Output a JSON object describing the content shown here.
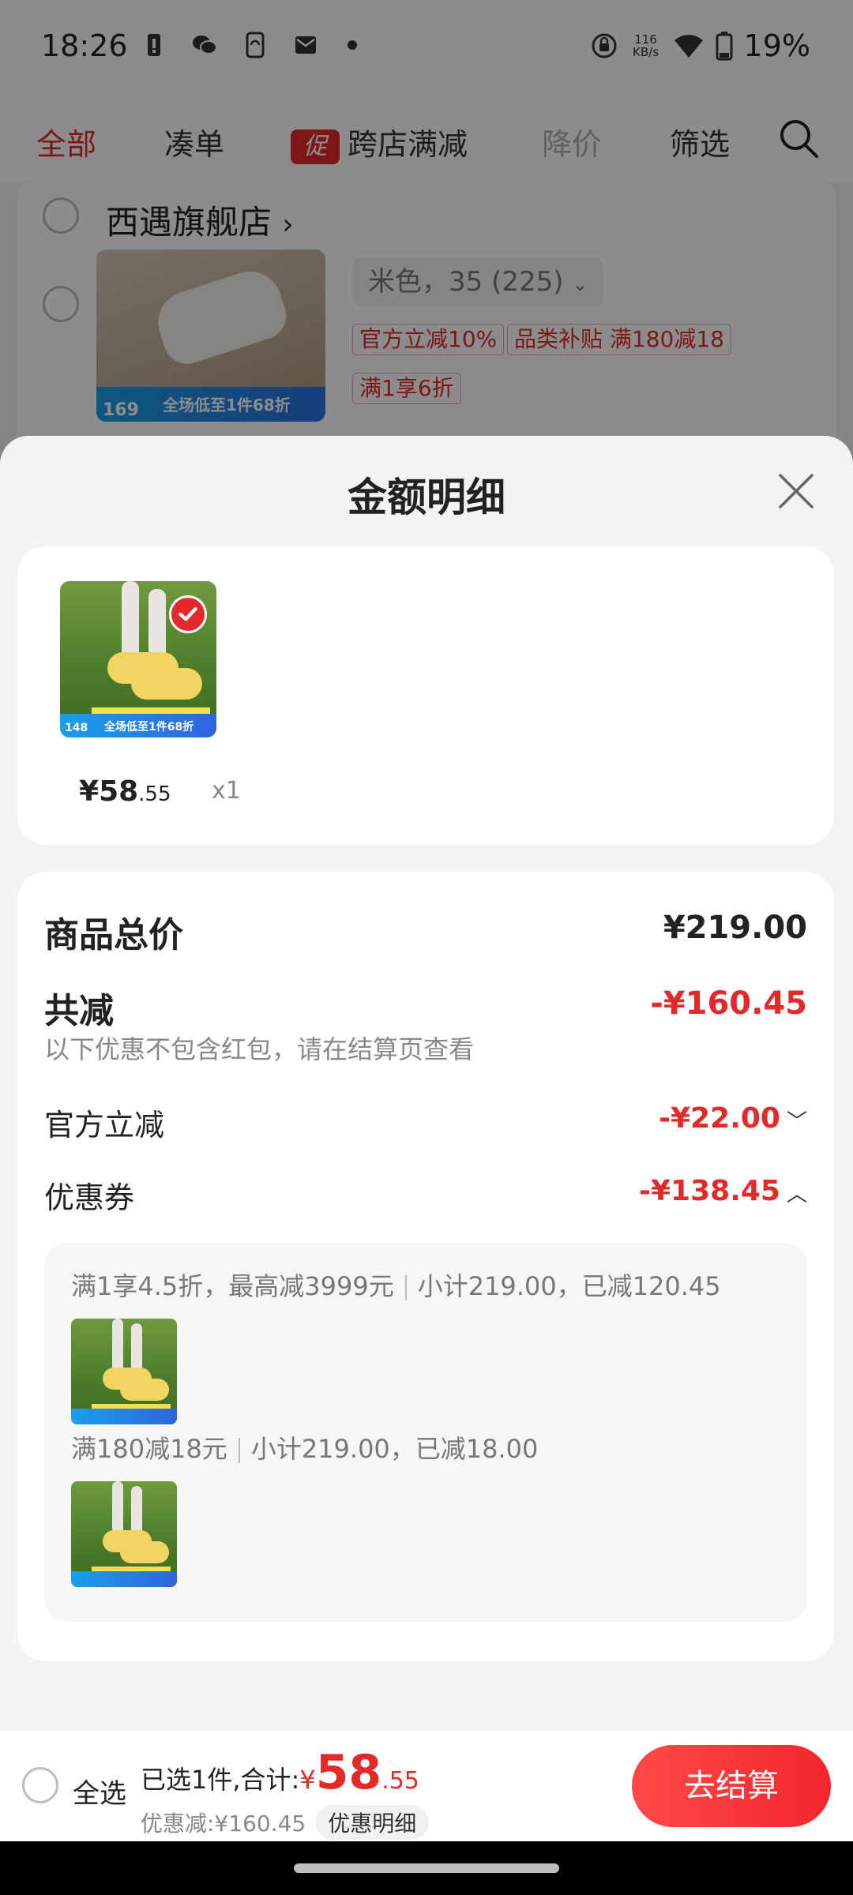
{
  "status_bar": {
    "time": "18:26",
    "netspeed_value": "116",
    "netspeed_unit": "KB/s",
    "battery": "19%",
    "icons": [
      "battery-alert-icon",
      "wechat-icon",
      "phone-sync-icon",
      "mail-icon",
      "dot-icon",
      "rotate-lock-icon",
      "wifi-icon",
      "battery-icon"
    ]
  },
  "tabs": {
    "all": "全部",
    "bundle": "凑单",
    "promo_badge": "促",
    "cross_store": "跨店满减",
    "price_drop": "降价",
    "filter": "筛选"
  },
  "background_shop": {
    "name": "西遇旗舰店",
    "chevron": "›",
    "spec": "米色，35 (225)",
    "tags": [
      "官方立减10%",
      "品类补贴 满180减18",
      "满1享6折"
    ],
    "image_price": "169",
    "image_banner": "全场低至1件68折"
  },
  "sheet": {
    "title": "金额明细",
    "item": {
      "price_symbol": "¥",
      "price_int": "58",
      "price_dec": ".55",
      "qty": "x1",
      "image_price": "148",
      "image_banner": "全场低至1件68折"
    },
    "details": {
      "total_label": "商品总价",
      "total_value": "¥219.00",
      "reduce_label": "共减",
      "reduce_value": "-¥160.45",
      "note": "以下优惠不包含红包，请在结算页查看",
      "official_label": "官方立减",
      "official_value": "-¥22.00",
      "coupon_label": "优惠券",
      "coupon_value": "-¥138.45",
      "chevron_down": "﹀",
      "chevron_up": "︿"
    },
    "coupons": [
      {
        "rule": "满1享4.5折，最高减3999元",
        "detail": "小计219.00，已减120.45"
      },
      {
        "rule": "满180减18元",
        "detail": "小计219.00，已减18.00"
      }
    ]
  },
  "checkout": {
    "select_all": "全选",
    "summary_prefix": "已选1件,合计:",
    "total_symbol": "¥",
    "total_int": "58",
    "total_dec": ".55",
    "discount_text": "优惠减:¥160.45",
    "discount_detail": "优惠明细",
    "button": "去结算"
  },
  "colors": {
    "accent_red": "#e4292b",
    "button_gradient": [
      "#ff4a48",
      "#f2262c"
    ],
    "muted_text": "#888888"
  }
}
